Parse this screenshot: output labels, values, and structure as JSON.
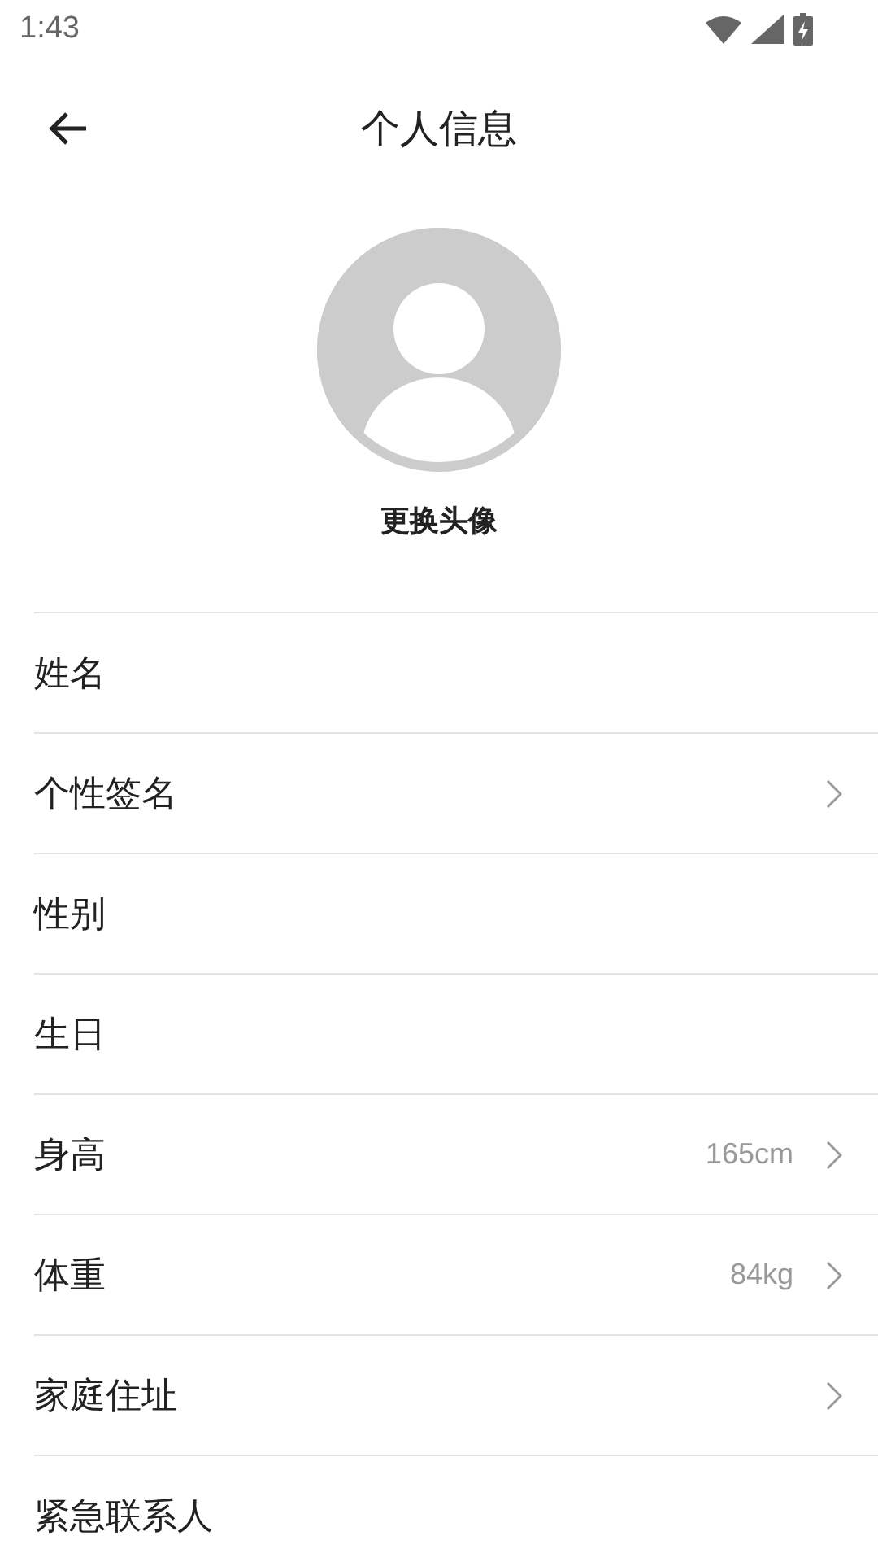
{
  "status_bar": {
    "time": "1:43"
  },
  "header": {
    "title": "个人信息"
  },
  "avatar": {
    "action": "更换头像"
  },
  "rows": [
    {
      "label": "姓名",
      "chevron": false
    },
    {
      "label": "个性签名",
      "chevron": true
    },
    {
      "label": "性别",
      "chevron": false
    },
    {
      "label": "生日",
      "chevron": false
    },
    {
      "label": "身高",
      "value": "165cm",
      "chevron": true
    },
    {
      "label": "体重",
      "value": "84kg",
      "chevron": true
    },
    {
      "label": "家庭住址",
      "chevron": true
    },
    {
      "label": "紧急联系人",
      "chevron": false
    }
  ]
}
